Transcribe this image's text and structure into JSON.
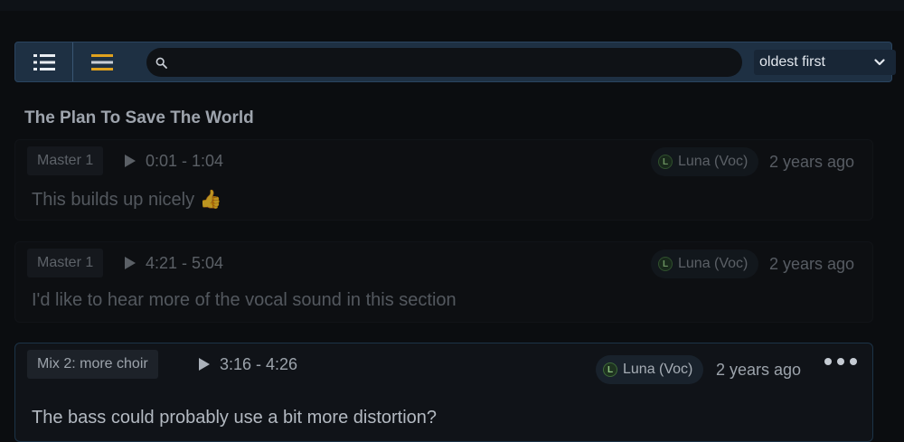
{
  "toolbar": {
    "list_icon": "list-icon",
    "compact_icon": "menu-lines-icon",
    "search": {
      "value": "",
      "placeholder": ""
    },
    "sort": {
      "selected": "oldest first"
    }
  },
  "song_title": "The Plan To Save The World",
  "comments": [
    {
      "tag": "Master 1",
      "range": "0:01 - 1:04",
      "user_initial": "L",
      "user": "Luna (Voc)",
      "time": "2 years ago",
      "text": "This builds up nicely 👍"
    },
    {
      "tag": "Master 1",
      "range": "4:21 - 5:04",
      "user_initial": "L",
      "user": "Luna (Voc)",
      "time": "2 years ago",
      "text": "I'd like to hear more of the vocal sound in this section"
    },
    {
      "tag": "Mix 2:  more choir",
      "range": "3:16 - 4:26",
      "user_initial": "L",
      "user": "Luna (Voc)",
      "time": "2 years ago",
      "text": "The bass could probably use a bit more distortion?"
    }
  ],
  "colors": {
    "accent": "#e0a21e",
    "toolbar": "#1e3043",
    "avatar": "#8fc47f"
  }
}
